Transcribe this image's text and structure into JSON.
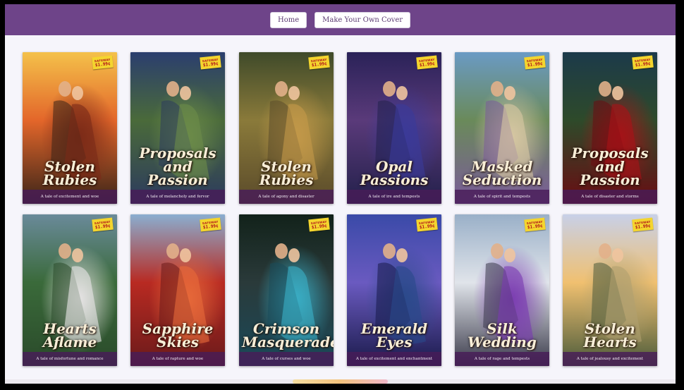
{
  "nav": {
    "home_label": "Home",
    "make_label": "Make Your Own Cover"
  },
  "price_tag": {
    "brand": "SAFEWAY",
    "amount": "$1.99¢"
  },
  "covers": [
    {
      "title": "Stolen Rubies",
      "tagline": "A tale of excitement and woe",
      "colors": [
        "#f4c14a",
        "#e3662a",
        "#7a2a18",
        "#3a2418"
      ]
    },
    {
      "title": "Proposals and Passion",
      "tagline": "A tale of melancholy and fervor",
      "colors": [
        "#2b3e6e",
        "#4a6a3a",
        "#6d8c4a",
        "#2c3a5e"
      ]
    },
    {
      "title": "Stolen Rubies",
      "tagline": "A tale of agony and disaster",
      "colors": [
        "#3f4a2a",
        "#8a7a3a",
        "#c49a4a",
        "#5a4a2a"
      ]
    },
    {
      "title": "Opal Passions",
      "tagline": "A tale of ire and tempests",
      "colors": [
        "#2a2258",
        "#5a3a7a",
        "#3a3a9a",
        "#22204a"
      ]
    },
    {
      "title": "Masked Seduction",
      "tagline": "A tale of spirit and tempests",
      "colors": [
        "#6a9ac4",
        "#6a8a5a",
        "#d8c8a4",
        "#7a5a9a"
      ]
    },
    {
      "title": "Proposals and Passion",
      "tagline": "A tale of disaster and storms",
      "colors": [
        "#1c3a4a",
        "#2e4a2a",
        "#a81218",
        "#6a0c12"
      ]
    },
    {
      "title": "Hearts Aflame",
      "tagline": "A tale of misfortune and romance",
      "colors": [
        "#6a8a9a",
        "#3a6a3a",
        "#eae6e8",
        "#2a4a2a"
      ]
    },
    {
      "title": "Sapphire Skies",
      "tagline": "A tale of rapture and woe",
      "colors": [
        "#8aaed0",
        "#b82a22",
        "#e86a3a",
        "#6a1a1a"
      ]
    },
    {
      "title": "Crimson Masquerade",
      "tagline": "A tale of curses and woe",
      "colors": [
        "#12221a",
        "#2a3a3a",
        "#3ab0c8",
        "#1a4a5a"
      ]
    },
    {
      "title": "Emerald Eyes",
      "tagline": "A tale of excitement and enchantment",
      "colors": [
        "#3a4aa8",
        "#6a5ac0",
        "#2a4a8a",
        "#1a1a4a"
      ]
    },
    {
      "title": "Silk Wedding",
      "tagline": "A tale of rage and tempests",
      "colors": [
        "#9ab0c8",
        "#e0e4ea",
        "#7a3ab0",
        "#3a3a4a"
      ]
    },
    {
      "title": "Stolen Hearts",
      "tagline": "A tale of jealousy and excitement",
      "colors": [
        "#c8d0e8",
        "#f0c070",
        "#b0a070",
        "#4a5a3a"
      ]
    }
  ]
}
